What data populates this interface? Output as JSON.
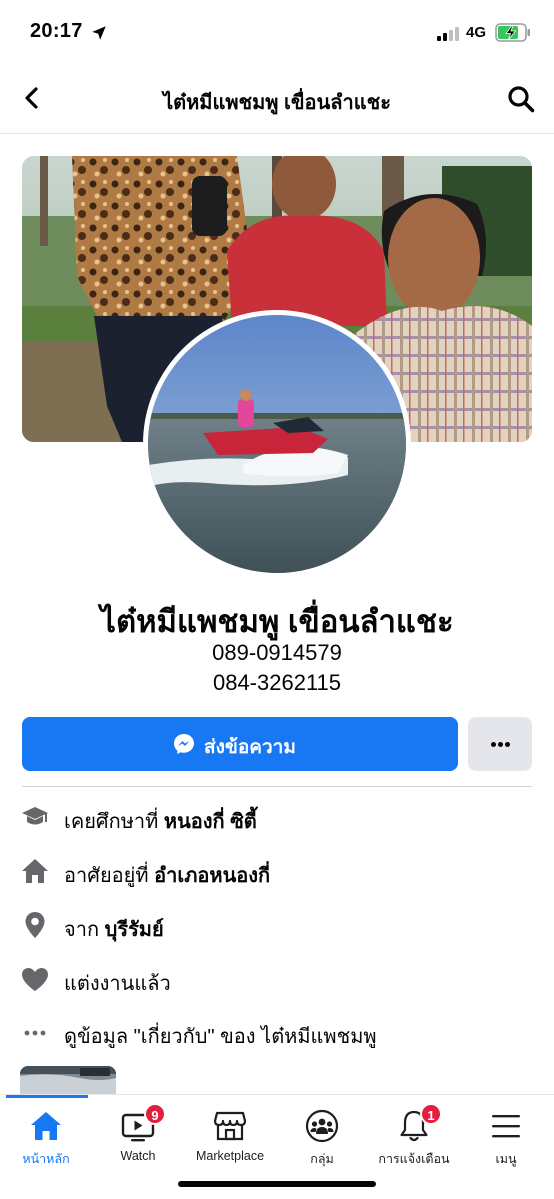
{
  "status_bar": {
    "time": "20:17",
    "network": "4G",
    "battery_state": "charging",
    "location_icon": "location-arrow-icon"
  },
  "header": {
    "title": "ไต๋หมีแพชมพู เขื่อนลำแชะ",
    "back_icon": "back-chevron-icon",
    "search_icon": "search-icon"
  },
  "profile": {
    "name": "ไต๋หมีแพชมพู เขื่อนลำแชะ",
    "phones": [
      "089-0914579",
      "084-3262115"
    ],
    "cover_description": "cover-photo",
    "avatar_description": "profile-photo"
  },
  "actions": {
    "message_label": "ส่งข้อความ",
    "message_icon": "messenger-icon",
    "more_icon": "more-dots-icon"
  },
  "details": [
    {
      "icon": "graduation-cap-icon",
      "prefix": "เคยศึกษาที่ ",
      "bold": "หนองกี่ ซิตี้"
    },
    {
      "icon": "home-icon",
      "prefix": "อาศัยอยู่ที่ ",
      "bold": "อำเภอหนองกี่"
    },
    {
      "icon": "location-pin-icon",
      "prefix": "จาก ",
      "bold": "บุรีรัมย์"
    },
    {
      "icon": "heart-icon",
      "prefix": "",
      "bold": "แต่งงานแล้ว"
    },
    {
      "icon": "more-dots-icon",
      "prefix": "ดูข้อมูล \"เกี่ยวกับ\" ของ ไต๋หมีแพชมพู",
      "bold": ""
    }
  ],
  "tab_bar": {
    "tabs": [
      {
        "label": "หน้าหลัก",
        "icon": "home-icon",
        "active": true,
        "badge": ""
      },
      {
        "label": "Watch",
        "icon": "watch-icon",
        "active": false,
        "badge": "9"
      },
      {
        "label": "Marketplace",
        "icon": "marketplace-icon",
        "active": false,
        "badge": ""
      },
      {
        "label": "กลุ่ม",
        "icon": "groups-icon",
        "active": false,
        "badge": ""
      },
      {
        "label": "การแจ้งเตือน",
        "icon": "bell-icon",
        "active": false,
        "badge": "1"
      },
      {
        "label": "เมนู",
        "icon": "menu-icon",
        "active": false,
        "badge": ""
      }
    ]
  },
  "colors": {
    "accent": "#1877f2",
    "badge": "#e41e3f",
    "icon_gray": "#65676b",
    "button_gray": "#e4e6eb"
  }
}
